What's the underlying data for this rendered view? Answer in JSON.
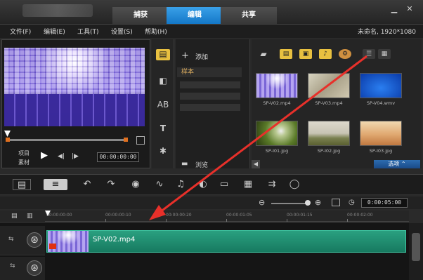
{
  "tabs": {
    "capture": "捕获",
    "edit": "编辑",
    "share": "共享"
  },
  "window_controls": {
    "minimize": "▁",
    "close": "✕"
  },
  "menu": [
    "文件(F)",
    "编辑(E)",
    "工具(T)",
    "设置(S)",
    "帮助(H)"
  ],
  "project_info": "未命名, 1920*1080",
  "player": {
    "project_label": "项目",
    "clip_label": "素材",
    "timecode": "00:00:00:00"
  },
  "library": {
    "add_label": "添加",
    "sample_label": "样本",
    "browse_label": "浏览",
    "options_label": "选项"
  },
  "media": [
    {
      "caption": "SP-V02.mp4",
      "kind": "purple"
    },
    {
      "caption": "SP-V03.mp4",
      "kind": "sepia"
    },
    {
      "caption": "SP-V04.wmv",
      "kind": "blue"
    },
    {
      "caption": "SP-I01.jpg",
      "kind": "dandelion"
    },
    {
      "caption": "SP-I02.jpg",
      "kind": "field"
    },
    {
      "caption": "SP-I03.jpg",
      "kind": "desert"
    }
  ],
  "timeline": {
    "timecode": "0:00:05:00",
    "ruler_labels": [
      "00:00:00:00",
      "00:00:00:10",
      "00:00:00:20",
      "00:00:01:05",
      "00:00:01:15",
      "00:00:02:00"
    ],
    "clip_name": "SP-V02.mp4"
  },
  "colors": {
    "accent": "#1f8ae0",
    "clip": "#1f8f70",
    "arrow": "#e8302a"
  }
}
